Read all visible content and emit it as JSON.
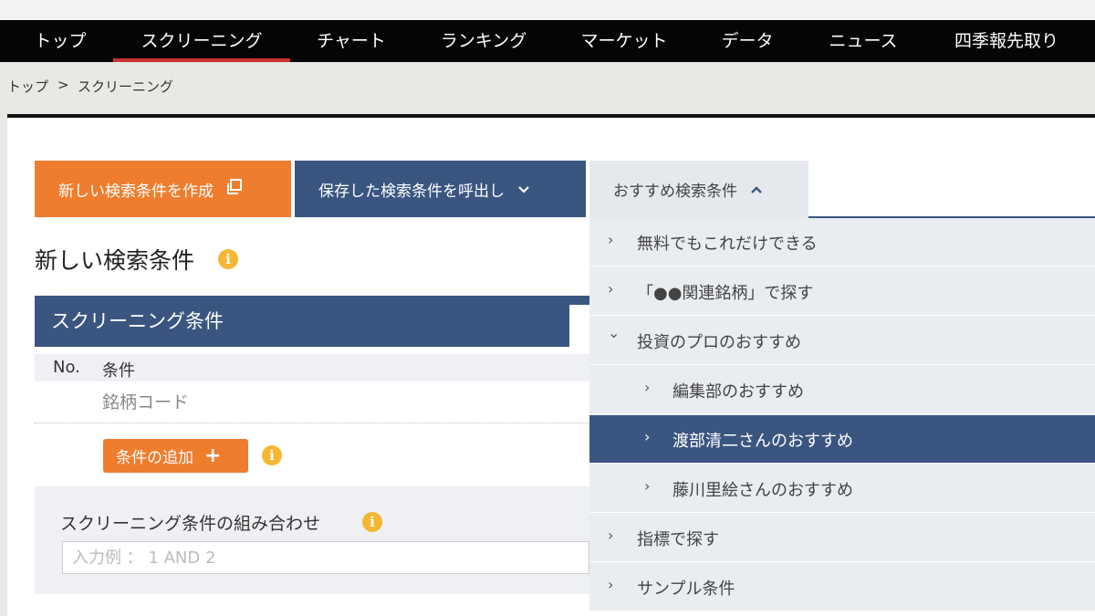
{
  "nav": {
    "items": [
      {
        "label": "トップ"
      },
      {
        "label": "スクリーニング"
      },
      {
        "label": "チャート"
      },
      {
        "label": "ランキング"
      },
      {
        "label": "マーケット"
      },
      {
        "label": "データ"
      },
      {
        "label": "ニュース"
      },
      {
        "label": "四季報先取り"
      }
    ],
    "active": "スクリーニング",
    "active_color": "#c8322e"
  },
  "breadcrumb": {
    "items": [
      "トップ",
      "スクリーニング"
    ],
    "separator": ">"
  },
  "toolbar": {
    "new_label": "新しい検索条件を作成",
    "new_icon": "copy-window-icon",
    "saved_label": "保存した検索条件を呼出し",
    "saved_icon": "chevron-down-icon",
    "recommended_label": "おすすめ検索条件",
    "recommended_icon": "chevron-up-icon"
  },
  "main": {
    "heading": "新しい検索条件",
    "info_glyph": "i",
    "conditions": {
      "title": "スクリーニング条件",
      "col_no": "No.",
      "col_condition": "条件",
      "rows": [
        "銘柄コード"
      ],
      "add_label": "条件の追加",
      "add_glyph": "+"
    },
    "combination": {
      "title": "スクリーニング条件の組み合わせ",
      "placeholder": "入力例 ： 1 AND 2",
      "value": ""
    }
  },
  "dropdown": {
    "items": [
      {
        "label": "無料でもこれだけできる",
        "chevron": "›",
        "level": 0,
        "selected": false
      },
      {
        "label": "「●●関連銘柄」で探す",
        "chevron": "›",
        "level": 0,
        "selected": false
      },
      {
        "label": "投資のプロのおすすめ",
        "chevron": "⌄",
        "level": 0,
        "selected": false
      },
      {
        "label": "編集部のおすすめ",
        "chevron": "›",
        "level": 1,
        "selected": false
      },
      {
        "label": "渡部清二さんのおすすめ",
        "chevron": "›",
        "level": 1,
        "selected": true
      },
      {
        "label": "藤川里絵さんのおすすめ",
        "chevron": "›",
        "level": 1,
        "selected": false
      },
      {
        "label": "指標で探す",
        "chevron": "›",
        "level": 0,
        "selected": false
      },
      {
        "label": "サンプル条件",
        "chevron": "›",
        "level": 0,
        "selected": false
      }
    ]
  },
  "colors": {
    "orange": "#ef7d2e",
    "navy": "#3a5680",
    "info_yellow": "#f5b731",
    "nav_bg": "#050505"
  }
}
